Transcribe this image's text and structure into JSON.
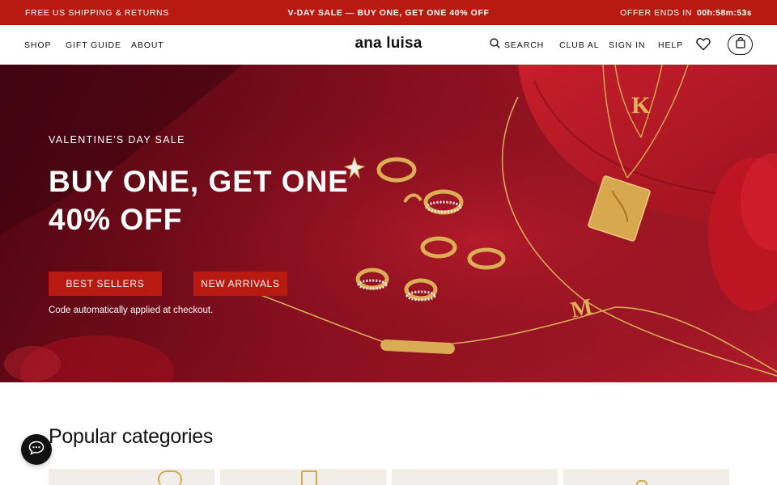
{
  "announcement": {
    "left": "FREE US SHIPPING & RETURNS",
    "center": "V-DAY SALE — BUY ONE, GET ONE 40% OFF",
    "right_label": "OFFER ENDS IN",
    "timer": "00h:58m:53s"
  },
  "nav": {
    "shop": "SHOP",
    "gift_guide": "GIFT GUIDE",
    "about": "ABOUT",
    "logo": "ana luisa",
    "search": "SEARCH",
    "club": "CLUB AL",
    "sign_in": "SIGN IN",
    "help": "HELP",
    "icons": [
      "search-icon",
      "heart-icon",
      "bag-icon"
    ]
  },
  "hero": {
    "eyebrow": "VALENTINE'S DAY SALE",
    "headline_line1": "BUY ONE, GET ONE",
    "headline_line2": "40% OFF",
    "button_best_sellers": "BEST SELLERS",
    "button_new_arrivals": "NEW ARRIVALS",
    "note": "Code automatically applied at checkout.",
    "pendant_letters": [
      "K",
      "M"
    ]
  },
  "categories": {
    "title": "Popular categories"
  },
  "colors": {
    "brand_red": "#b81911",
    "text": "#111111",
    "gold": "#d6a84a"
  }
}
